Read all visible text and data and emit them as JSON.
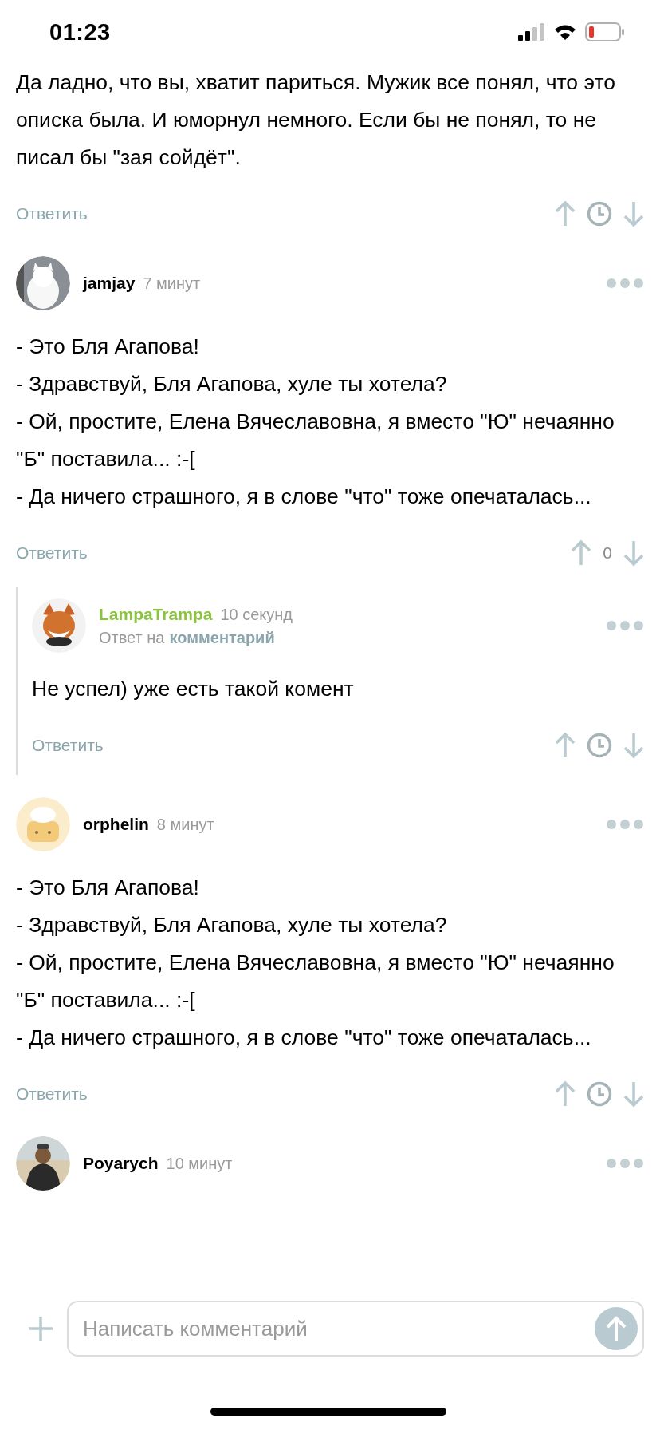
{
  "status_bar": {
    "time": "01:23"
  },
  "comments": [
    {
      "body": [
        "Да ладно, что вы, хватит париться. Мужик все понял, что это описка была. И юморнул немного. Если бы не понял, то не писал бы \"зая сойдёт\"."
      ],
      "reply_label": "Ответить"
    },
    {
      "author": "jamjay",
      "time": "7 минут",
      "author_highlighted": false,
      "body": [
        "- Это Бля Агапова!",
        "- Здравствуй, Бля Агапова, хуле ты хотела?",
        "- Ой, простите, Елена Вячеславовна, я вместо \"Ю\" нечаянно \"Б\" поставила... :-[",
        "- Да ничего страшного, я в слове \"что\" тоже опечаталась..."
      ],
      "reply_label": "Ответить",
      "rating": "0",
      "children": [
        {
          "author": "LampaTrampa",
          "time": "10 секунд",
          "author_highlighted": true,
          "reply_to_prefix": "Ответ на",
          "reply_to_link": "комментарий",
          "body": [
            "Не успел) уже есть такой комент"
          ],
          "reply_label": "Ответить"
        }
      ]
    },
    {
      "author": "orphelin",
      "time": "8 минут",
      "author_highlighted": false,
      "body": [
        "- Это Бля Агапова!",
        "- Здравствуй, Бля Агапова, хуле ты хотела?",
        "- Ой, простите, Елена Вячеславовна, я вместо \"Ю\" нечаянно \"Б\" поставила... :-[",
        "- Да ничего страшного, я в слове \"что\" тоже опечаталась..."
      ],
      "reply_label": "Ответить"
    },
    {
      "author": "Poyarych",
      "time": "10 минут",
      "author_highlighted": false
    }
  ],
  "composer": {
    "placeholder": "Написать комментарий"
  }
}
